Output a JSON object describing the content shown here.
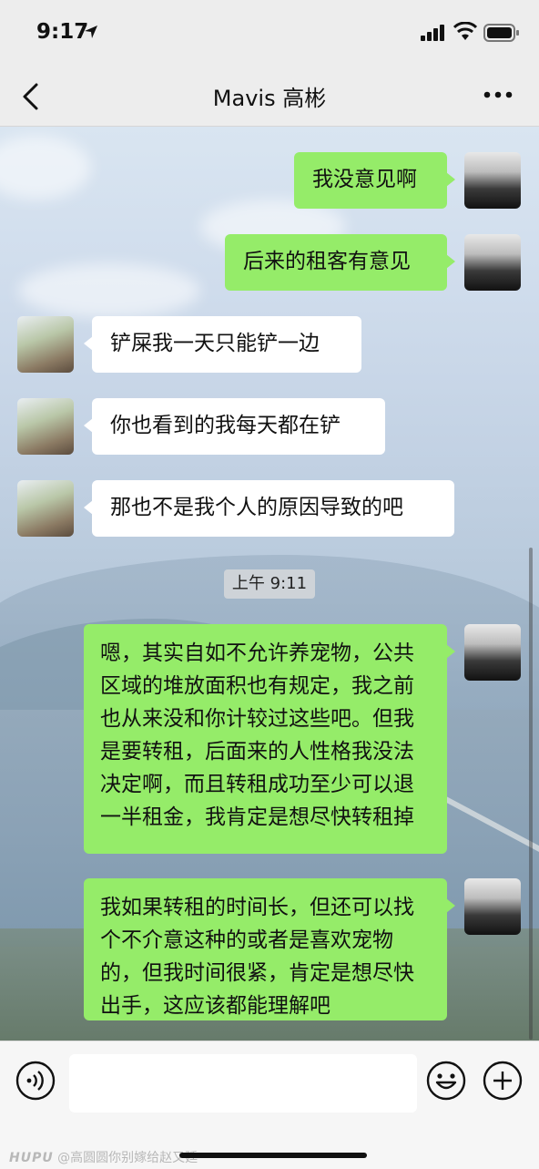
{
  "status_bar": {
    "time": "9:17"
  },
  "nav": {
    "title": "Mavis 高彬"
  },
  "messages": [
    {
      "sender": "me",
      "text": "我没意见啊"
    },
    {
      "sender": "me",
      "text": "后来的租客有意见"
    },
    {
      "sender": "other",
      "text": "铲屎我一天只能铲一边"
    },
    {
      "sender": "other",
      "text": "你也看到的我每天都在铲"
    },
    {
      "sender": "other",
      "text": "那也不是我个人的原因导致的吧"
    },
    {
      "sender": "me",
      "text": "嗯，其实自如不允许养宠物，公共区域的堆放面积也有规定，我之前也从来没和你计较过这些吧。但我是要转租，后面来的人性格我没法决定啊，而且转租成功至少可以退一半租金，我肯定是想尽快转租掉"
    },
    {
      "sender": "me",
      "text": "我如果转租的时间长，但还可以找个不介意这种的或者是喜欢宠物的，但我时间很紧，肯定是想尽快出手，这应该都能理解吧"
    }
  ],
  "timestamp": "上午 9:11",
  "input": {
    "value": ""
  },
  "watermark": {
    "brand": "HUPU",
    "text": "@高圆圆你别嫁给赵又廷"
  },
  "colors": {
    "bubble_me": "#95ec69",
    "bubble_other": "#ffffff",
    "nav_bg": "#ededed"
  },
  "icons": [
    "location-arrow-icon",
    "signal-icon",
    "wifi-icon",
    "battery-icon",
    "back-chevron-icon",
    "more-dots-icon",
    "voice-icon",
    "emoji-icon",
    "plus-icon"
  ]
}
